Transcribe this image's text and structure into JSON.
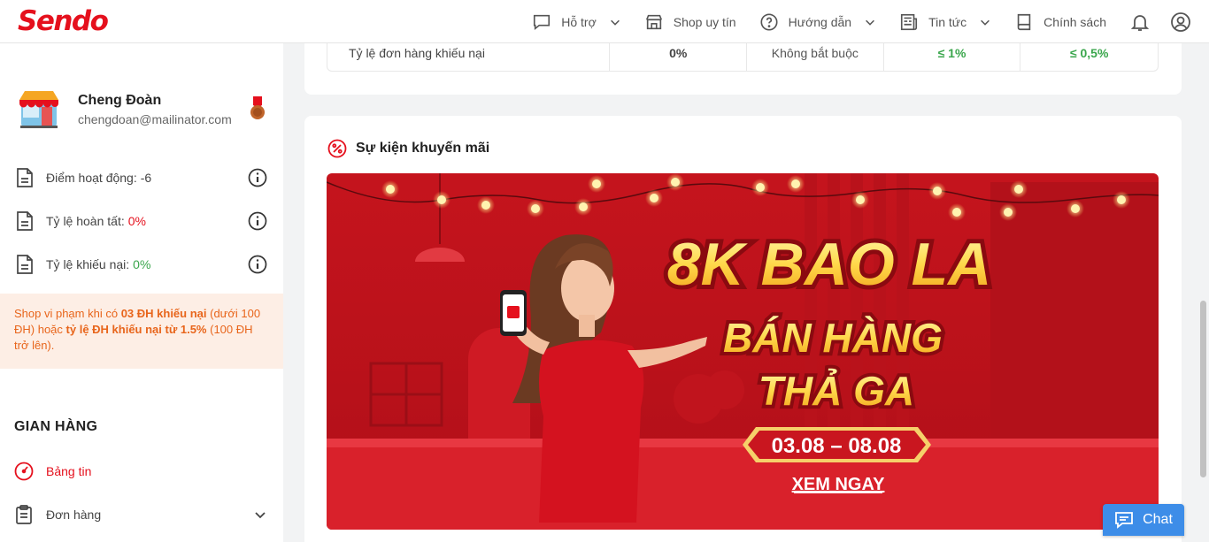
{
  "brand": {
    "logo": "Sendo",
    "accent": "#e5101d"
  },
  "nav": {
    "support": "Hỗ trợ",
    "trusted_shop": "Shop uy tín",
    "guide": "Hướng dẫn",
    "news": "Tin tức",
    "policy": "Chính sách",
    "icons": [
      "chat-bubble-icon",
      "store-icon",
      "help-circle-icon",
      "news-icon",
      "book-icon",
      "bell-icon",
      "user-icon"
    ]
  },
  "profile": {
    "name": "Cheng Đoàn",
    "email": "chengdoan@mailinator.com"
  },
  "stats": {
    "activity_label": "Điểm hoạt động:",
    "activity_value": "-6",
    "completion_label": "Tỷ lệ hoàn tất:",
    "completion_value": "0%",
    "complaint_label": "Tỷ lệ khiếu nại:",
    "complaint_value": "0%"
  },
  "warning": {
    "p1": "Shop vi phạm khi có ",
    "b1": "03 ĐH khiếu nại",
    "p2": " (dưới 100 ĐH) hoặc ",
    "b2": "tỷ lệ ĐH khiếu nại từ 1.5%",
    "p3": " (100 ĐH trở lên)."
  },
  "sidebar": {
    "section_title": "GIAN HÀNG",
    "items": [
      {
        "label": "Bảng tin",
        "active": true
      },
      {
        "label": "Đơn hàng",
        "active": false
      }
    ]
  },
  "table_row": {
    "metric": "Tỷ lệ đơn hàng khiếu nại",
    "value": "0%",
    "requirement": "Không bắt buộc",
    "threshold_1": "≤ 1%",
    "threshold_2": "≤ 0,5%"
  },
  "promo": {
    "title": "Sự kiện khuyến mãi",
    "banner": {
      "headline": "8K BAO LA",
      "line2": "BÁN HÀNG",
      "line3": "THẢ GA",
      "dates": "03.08 – 08.08",
      "cta": "XEM NGAY"
    }
  },
  "chat": {
    "label": "Chat"
  }
}
